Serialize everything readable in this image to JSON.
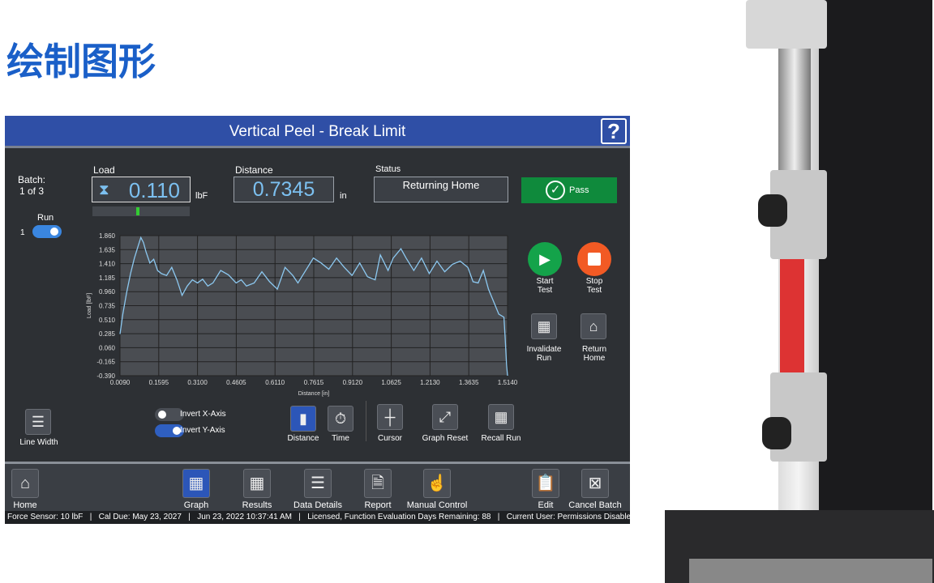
{
  "headline": "绘制图形",
  "title": "Vertical Peel - Break Limit",
  "help": "?",
  "batch": {
    "label": "Batch:",
    "value": "1 of 3"
  },
  "run": {
    "label": "Run",
    "index": "1",
    "on": true
  },
  "load": {
    "label": "Load",
    "value": "0.110",
    "unit": "lbF"
  },
  "distance": {
    "label": "Distance",
    "value": "0.7345",
    "unit": "in"
  },
  "status": {
    "label": "Status",
    "value": "Returning Home"
  },
  "result": {
    "label": "Pass",
    "color": "#0f8a3c"
  },
  "side": {
    "start": "Start\nTest",
    "stop": "Stop\nTest",
    "invalidate": "Invalidate\nRun",
    "return": "Return\nHome"
  },
  "tools": {
    "line_width": "Line Width",
    "invert_x": "Invert X-Axis",
    "invert_x_on": false,
    "invert_y": "Invert Y-Axis",
    "invert_y_on": true,
    "distance": "Distance",
    "time": "Time",
    "cursor": "Cursor",
    "graph_reset": "Graph Reset",
    "recall_run": "Recall Run"
  },
  "nav": {
    "home": "Home",
    "graph": "Graph",
    "results": "Results",
    "data_details": "Data Details",
    "report": "Report",
    "manual": "Manual Control",
    "edit": "Edit",
    "cancel": "Cancel Batch"
  },
  "statusbar": "Force Sensor: 10 lbF   |   Cal Due: May 23, 2027   |   Jun 23, 2022 10:37:41 AM   |   Licensed, Function Evaluation Days Remaining: 88   |   Current User: Permissions Disabled",
  "chart_data": {
    "type": "line",
    "xlabel": "Distance [in]",
    "ylabel": "Load [lbF]",
    "xlim": [
      0.009,
      1.514
    ],
    "ylim": [
      -0.39,
      1.86
    ],
    "xticks": [
      "0.0090",
      "0.1595",
      "0.3100",
      "0.4605",
      "0.6110",
      "0.7615",
      "0.9120",
      "1.0625",
      "1.2130",
      "1.3635",
      "1.5140"
    ],
    "yticks": [
      "1.860",
      "1.635",
      "1.410",
      "1.185",
      "0.960",
      "0.735",
      "0.510",
      "0.285",
      "0.060",
      "-0.165",
      "-0.390"
    ],
    "grid": true,
    "color": "#8cc8f0",
    "x": [
      0.009,
      0.02,
      0.035,
      0.05,
      0.065,
      0.08,
      0.09,
      0.1,
      0.11,
      0.125,
      0.14,
      0.155,
      0.17,
      0.19,
      0.21,
      0.23,
      0.25,
      0.27,
      0.29,
      0.31,
      0.33,
      0.35,
      0.37,
      0.4,
      0.43,
      0.46,
      0.48,
      0.5,
      0.53,
      0.56,
      0.59,
      0.62,
      0.65,
      0.68,
      0.7,
      0.73,
      0.76,
      0.79,
      0.82,
      0.85,
      0.88,
      0.91,
      0.94,
      0.97,
      1.0,
      1.02,
      1.05,
      1.07,
      1.1,
      1.12,
      1.15,
      1.18,
      1.21,
      1.24,
      1.27,
      1.3,
      1.33,
      1.36,
      1.38,
      1.4,
      1.42,
      1.44,
      1.46,
      1.48,
      1.5,
      1.505,
      1.51,
      1.514
    ],
    "y": [
      0.28,
      0.6,
      0.95,
      1.25,
      1.5,
      1.7,
      1.83,
      1.75,
      1.6,
      1.42,
      1.48,
      1.3,
      1.25,
      1.22,
      1.35,
      1.15,
      0.9,
      1.05,
      1.15,
      1.1,
      1.16,
      1.05,
      1.1,
      1.3,
      1.23,
      1.1,
      1.15,
      1.05,
      1.1,
      1.28,
      1.12,
      1.0,
      1.35,
      1.22,
      1.1,
      1.3,
      1.5,
      1.42,
      1.32,
      1.5,
      1.35,
      1.22,
      1.42,
      1.2,
      1.15,
      1.55,
      1.3,
      1.5,
      1.65,
      1.5,
      1.3,
      1.5,
      1.25,
      1.45,
      1.28,
      1.4,
      1.45,
      1.35,
      1.12,
      1.1,
      1.3,
      1.0,
      0.8,
      0.6,
      0.55,
      0.2,
      -0.2,
      -0.39
    ]
  }
}
